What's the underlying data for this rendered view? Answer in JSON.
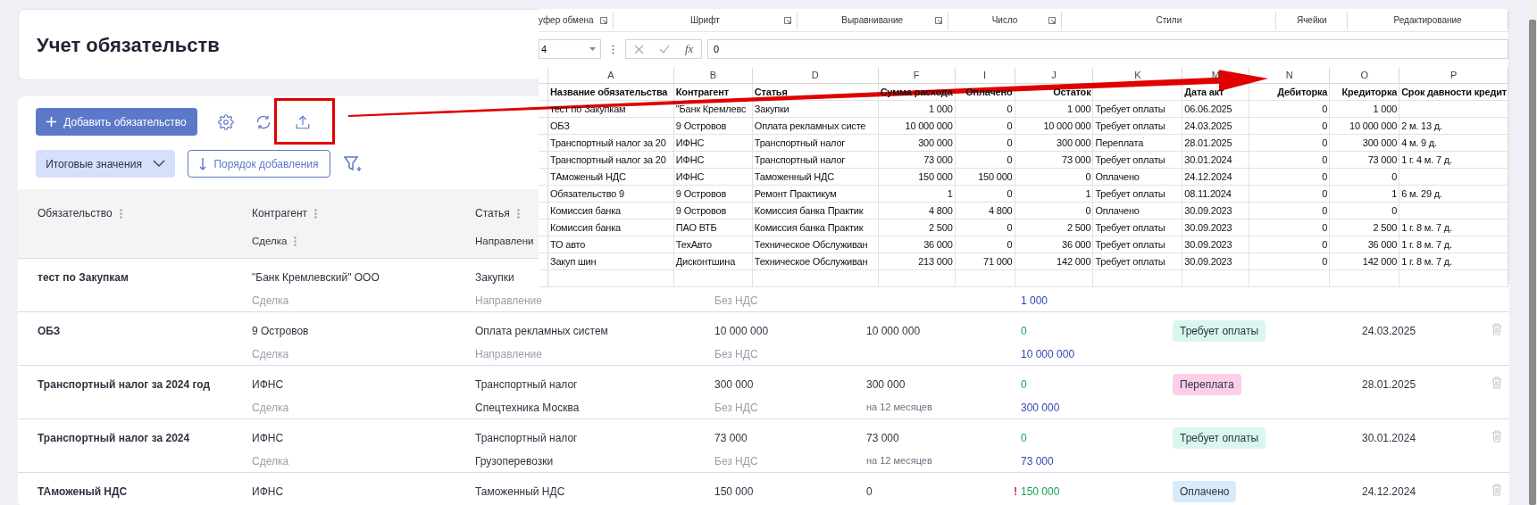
{
  "page": {
    "title": "Учет обязательств"
  },
  "toolbar": {
    "add_button": "Добавить обязательство",
    "totals_dropdown": "Итоговые значения",
    "sort_button": "Порядок добавления"
  },
  "table": {
    "columns": [
      {
        "label": "Обязательство"
      },
      {
        "label": "Контрагент",
        "sublabel": "Сделка"
      },
      {
        "label": "Статья",
        "sublabel": "Направлени"
      }
    ],
    "rows": [
      {
        "name": "тест по Закупкам",
        "counterparty": "\"Банк Кремлевский\" ООО",
        "deal": {
          "text": "Сделка",
          "placeholder": true
        },
        "article": "Закупки",
        "direction": {
          "text": "Направление",
          "placeholder": true
        },
        "column_4": {
          "line_2": "Без НДС"
        },
        "column_6": {
          "line_2": "1 000"
        }
      },
      {
        "name": "ОБЗ",
        "counterparty": "9 Островов",
        "deal": {
          "text": "Сделка",
          "placeholder": true
        },
        "article": "Оплата рекламных систем",
        "direction": {
          "text": "Направление",
          "placeholder": true
        },
        "column_4": {
          "line_1": "10 000 000",
          "line_2": "Без НДС"
        },
        "column_5": {
          "line_1": "10 000 000"
        },
        "column_6": {
          "line_1": "0",
          "line_2": "10 000 000"
        },
        "status": {
          "text": "Требует оплаты",
          "kind": "due"
        },
        "date": "24.03.2025",
        "deletable": true
      },
      {
        "name": "Транспортный налог за 2024 год",
        "counterparty": "ИФНС",
        "deal": {
          "text": "Сделка",
          "placeholder": true
        },
        "article": "Транспортный налог",
        "direction": {
          "text": "Спецтехника Москва",
          "placeholder": false
        },
        "column_4": {
          "line_1": "300 000",
          "line_2": "Без НДС"
        },
        "column_5": {
          "line_1": "300 000",
          "line_2": "на 12 месяцев"
        },
        "column_6": {
          "line_1": "0",
          "line_2": "300 000"
        },
        "status": {
          "text": "Переплата",
          "kind": "overpaid"
        },
        "date": "28.01.2025",
        "deletable": true
      },
      {
        "name": "Транспортный налог за 2024",
        "counterparty": "ИФНС",
        "deal": {
          "text": "Сделка",
          "placeholder": true
        },
        "article": "Транспортный налог",
        "direction": {
          "text": "Грузоперевозки",
          "placeholder": false
        },
        "column_4": {
          "line_1": "73 000",
          "line_2": "Без НДС"
        },
        "column_5": {
          "line_1": "73 000",
          "line_2": "на 12 месяцев"
        },
        "column_6": {
          "line_1": "0",
          "line_2": "73 000"
        },
        "status": {
          "text": "Требует оплаты",
          "kind": "due"
        },
        "date": "30.01.2024",
        "deletable": true
      },
      {
        "name": "ТАможеный НДС",
        "counterparty": "ИФНС",
        "article": "Таможенный НДС",
        "column_4": {
          "line_1": "150 000"
        },
        "column_5": {
          "line_1": "0"
        },
        "column_6": {
          "alert_mark": "!",
          "line_1": "150 000"
        },
        "status": {
          "text": "Оплачено",
          "kind": "paid"
        },
        "date": "24.12.2024",
        "deletable": true
      }
    ]
  },
  "spreadsheet": {
    "ribbon_groups": [
      {
        "label": "уфер обмена",
        "launcher": true
      },
      {
        "label": "Шрифт",
        "launcher": true
      },
      {
        "label": "Выравнивание",
        "launcher": true
      },
      {
        "label": "Число",
        "launcher": true
      },
      {
        "label": "Стили",
        "launcher": false
      },
      {
        "label": "Ячейки",
        "launcher": false
      },
      {
        "label": "Редактирование",
        "launcher": false
      }
    ],
    "name_box": "4",
    "function_label": "fx",
    "formula": "0",
    "columns": [
      {
        "letter": "A",
        "header": "Название обязательства",
        "kind": "text"
      },
      {
        "letter": "B",
        "header": "Контрагент",
        "kind": "text"
      },
      {
        "letter": "D",
        "header": "Статья",
        "kind": "text"
      },
      {
        "letter": "F",
        "header": "Сумма расхода",
        "kind": "number"
      },
      {
        "letter": "I",
        "header": "Оплачено",
        "kind": "number"
      },
      {
        "letter": "J",
        "header": "Остаток",
        "kind": "number"
      },
      {
        "letter": "K",
        "kind": "text"
      },
      {
        "letter": "M",
        "header": "Дата акт",
        "kind": "text"
      },
      {
        "letter": "N",
        "header": "Дебиторка",
        "kind": "number"
      },
      {
        "letter": "O",
        "header": "Кредиторка",
        "kind": "number"
      },
      {
        "letter": "P",
        "header": "Срок давности кредит",
        "kind": "text"
      }
    ],
    "rows": [
      {
        "A": "тест по Закупкам",
        "B": "\"Банк Кремлевс",
        "D": "Закупки",
        "F": "1 000",
        "I": "0",
        "J": "1 000",
        "K": "Требует оплаты",
        "M": "06.06.2025",
        "N": "0",
        "O": "1 000"
      },
      {
        "A": "ОБЗ",
        "B": "9 Островов",
        "D": "Оплата рекламных систе",
        "F": "10 000 000",
        "I": "0",
        "J": "10 000 000",
        "K": "Требует оплаты",
        "M": "24.03.2025",
        "N": "0",
        "O": "10 000 000",
        "P": "2 м. 13 д."
      },
      {
        "A": "Транспортный налог за 20",
        "B": "ИФНС",
        "D": "Транспортный налог",
        "F": "300 000",
        "I": "0",
        "J": "300 000",
        "K": "Переплата",
        "M": "28.01.2025",
        "N": "0",
        "O": "300 000",
        "P": "4 м. 9 д."
      },
      {
        "A": "Транспортный налог за 20",
        "B": "ИФНС",
        "D": "Транспортный налог",
        "F": "73 000",
        "I": "0",
        "J": "73 000",
        "K": "Требует оплаты",
        "M": "30.01.2024",
        "N": "0",
        "O": "73 000",
        "P": "1 г. 4 м. 7 д."
      },
      {
        "A": "ТАможеный НДС",
        "B": "ИФНС",
        "D": "Таможенный НДС",
        "F": "150 000",
        "I": "150 000",
        "J": "0",
        "K": "Оплачено",
        "M": "24.12.2024",
        "N": "0",
        "O": "0"
      },
      {
        "A": "Обязательство 9",
        "B": "9 Островов",
        "D": "Ремонт Практикум",
        "F": "1",
        "I": "0",
        "J": "1",
        "K": "Требует оплаты",
        "M": "08.11.2024",
        "N": "0",
        "O": "1",
        "P": "6 м. 29 д."
      },
      {
        "A": "Комиссия банка",
        "B": "9 Островов",
        "D": "Комиссия банка Практик",
        "F": "4 800",
        "I": "4 800",
        "J": "0",
        "K": "Оплачено",
        "M": "30.09.2023",
        "N": "0",
        "O": "0"
      },
      {
        "A": "Комиссия банка",
        "B": "ПАО ВТБ",
        "D": "Комиссия банка Практик",
        "F": "2 500",
        "I": "0",
        "J": "2 500",
        "K": "Требует оплаты",
        "M": "30.09.2023",
        "N": "0",
        "O": "2 500",
        "P": "1 г. 8 м. 7 д."
      },
      {
        "A": "ТО авто",
        "B": "ТехАвто",
        "D": "Техническое Обслуживан",
        "F": "36 000",
        "I": "0",
        "J": "36 000",
        "K": "Требует оплаты",
        "M": "30.09.2023",
        "N": "0",
        "O": "36 000",
        "P": "1 г. 8 м. 7 д."
      },
      {
        "A": "Закуп шин",
        "B": "Дисконтшина",
        "D": "Техническое Обслуживан",
        "F": "213 000",
        "I": "71 000",
        "J": "142 000",
        "K": "Требует оплаты",
        "M": "30.09.2023",
        "N": "0",
        "O": "142 000",
        "P": "1 г. 8 м. 7 д."
      }
    ]
  }
}
